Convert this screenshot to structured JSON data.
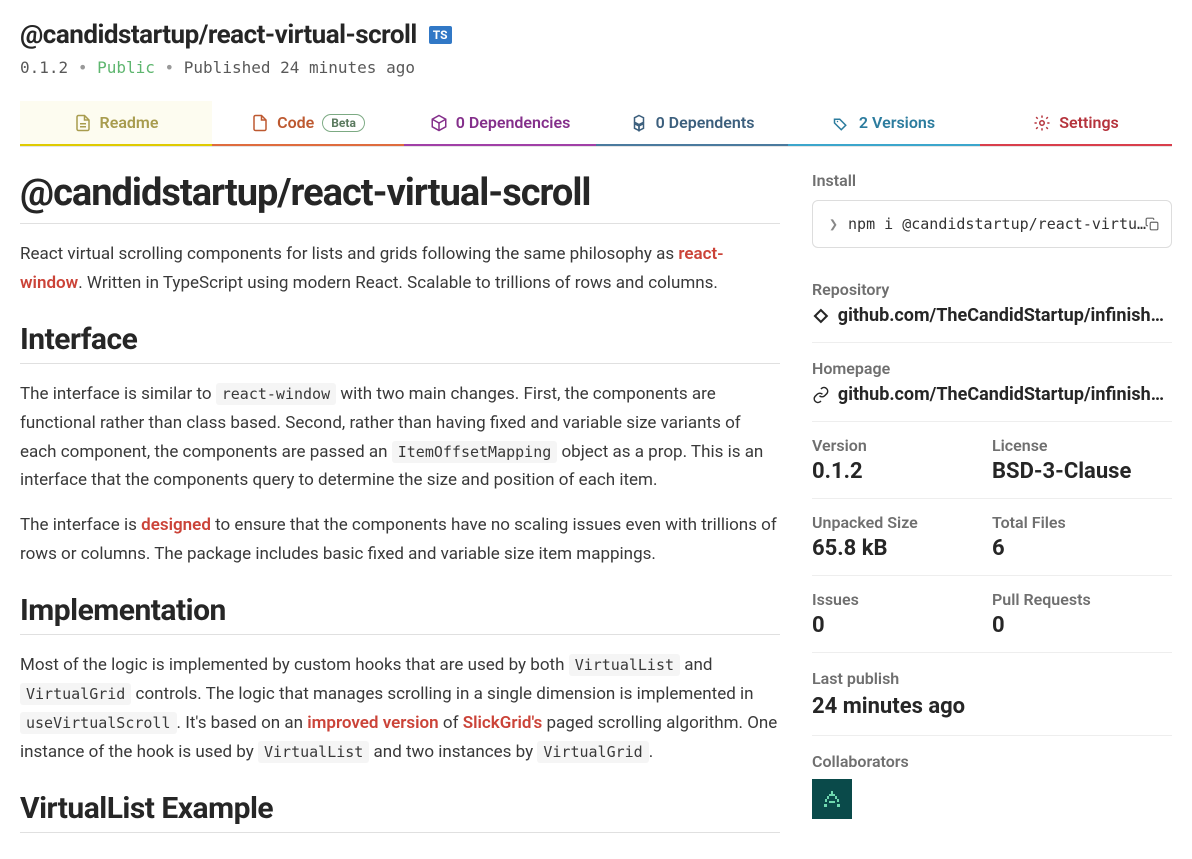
{
  "header": {
    "package_name": "@candidstartup/react-virtual-scroll",
    "ts_badge": "TS",
    "version": "0.1.2",
    "visibility": "Public",
    "published": "Published 24 minutes ago"
  },
  "tabs": {
    "readme": "Readme",
    "code": "Code",
    "code_badge": "Beta",
    "dependencies": "0 Dependencies",
    "dependents": "0 Dependents",
    "versions": "2 Versions",
    "settings": "Settings"
  },
  "content": {
    "title": "@candidstartup/react-virtual-scroll",
    "intro_pre": "React virtual scrolling components for lists and grids following the same philosophy as ",
    "intro_link": "react-window",
    "intro_post": ". Written in TypeScript using modern React. Scalable to trillions of rows and columns.",
    "h2_interface": "Interface",
    "iface_p1_a": "The interface is similar to ",
    "iface_p1_code1": "react-window",
    "iface_p1_b": " with two main changes. First, the components are functional rather than class based. Second, rather than having fixed and variable size variants of each component, the components are passed an ",
    "iface_p1_code2": "ItemOffsetMapping",
    "iface_p1_c": " object as a prop. This is an interface that the components query to determine the size and position of each item.",
    "iface_p2_a": "The interface is ",
    "iface_p2_link": "designed",
    "iface_p2_b": " to ensure that the components have no scaling issues even with trillions of rows or columns. The package includes basic fixed and variable size item mappings.",
    "h2_impl": "Implementation",
    "impl_p1_a": "Most of the logic is implemented by custom hooks that are used by both ",
    "impl_code1": "VirtualList",
    "impl_p1_b": " and ",
    "impl_code2": "VirtualGrid",
    "impl_p1_c": " controls. The logic that manages scrolling in a single dimension is implemented in ",
    "impl_code3": "useVirtualScroll",
    "impl_p1_d": ". It's based on an ",
    "impl_link1": "improved version",
    "impl_p1_e": " of ",
    "impl_link2": "SlickGrid's",
    "impl_p1_f": " paged scrolling algorithm. One instance of the hook is used by ",
    "impl_code4": "VirtualList",
    "impl_p1_g": " and two instances by ",
    "impl_code5": "VirtualGrid",
    "impl_p1_h": ".",
    "h2_example": "VirtualList Example"
  },
  "sidebar": {
    "install_label": "Install",
    "install_cmd": "npm i @candidstartup/react-virtual-s…",
    "repo_label": "Repository",
    "repo_url": "github.com/TheCandidStartup/infinisheet",
    "home_label": "Homepage",
    "home_url": "github.com/TheCandidStartup/infinishe…",
    "version_label": "Version",
    "version_val": "0.1.2",
    "license_label": "License",
    "license_val": "BSD-3-Clause",
    "size_label": "Unpacked Size",
    "size_val": "65.8 kB",
    "files_label": "Total Files",
    "files_val": "6",
    "issues_label": "Issues",
    "issues_val": "0",
    "pr_label": "Pull Requests",
    "pr_val": "0",
    "lastpub_label": "Last publish",
    "lastpub_val": "24 minutes ago",
    "collab_label": "Collaborators"
  }
}
